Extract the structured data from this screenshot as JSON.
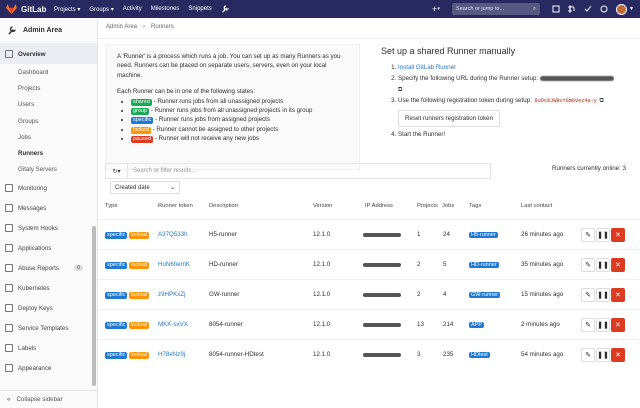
{
  "topbar": {
    "brand": "GitLab",
    "nav": [
      "Projects ▾",
      "Groups ▾",
      "Activity",
      "Milestones",
      "Snippets"
    ],
    "search_placeholder": "Search or jump to...",
    "colors": {
      "bg": "#292961"
    }
  },
  "sidebar": {
    "title": "Admin Area",
    "items": [
      {
        "label": "Overview",
        "active": true
      },
      {
        "label": "Dashboard",
        "sub": true
      },
      {
        "label": "Projects",
        "sub": true
      },
      {
        "label": "Users",
        "sub": true
      },
      {
        "label": "Groups",
        "sub": true
      },
      {
        "label": "Jobs",
        "sub": true
      },
      {
        "label": "Runners",
        "sub": true,
        "active": true
      },
      {
        "label": "Gitaly Servers",
        "sub": true
      },
      {
        "label": "Monitoring"
      },
      {
        "label": "Messages"
      },
      {
        "label": "System Hooks"
      },
      {
        "label": "Applications"
      },
      {
        "label": "Abuse Reports",
        "count": "0"
      },
      {
        "label": "Kubernetes"
      },
      {
        "label": "Deploy Keys"
      },
      {
        "label": "Service Templates"
      },
      {
        "label": "Labels"
      },
      {
        "label": "Appearance"
      }
    ],
    "collapse": "Collapse sidebar"
  },
  "breadcrumb": {
    "root": "Admin Area",
    "sep": "›",
    "current": "Runners"
  },
  "info": {
    "intro": "A 'Runner' is a process which runs a job. You can set up as many Runners as you need. Runners can be placed on separate users, servers, even on your local machine.",
    "states_title": "Each Runner can be in one of the following states:",
    "states": [
      {
        "badge": "shared",
        "text": "- Runner runs jobs from all unassigned projects"
      },
      {
        "badge": "group",
        "text": "- Runner runs jobs from all unassigned projects in its group"
      },
      {
        "badge": "specific",
        "text": "- Runner runs jobs from assigned projects"
      },
      {
        "badge": "locked",
        "text": "- Runner cannot be assigned to other projects"
      },
      {
        "badge": "paused",
        "text": "- Runner will not receive any new jobs"
      }
    ]
  },
  "setup": {
    "title": "Set up a shared Runner manually",
    "step1": "Install GitLab Runner",
    "step2": "Specify the following URL during the Runner setup:",
    "step3": "Use the following registration token during setup:",
    "token": "8uDc8JWBvYGm6vez4a-y",
    "reset": "Reset runners registration token",
    "step4": "Start the Runner!"
  },
  "filter": {
    "placeholder": "Search or filter results...",
    "online": "Runners currently online: 3",
    "sort": "Created date"
  },
  "table": {
    "headers": [
      "Type",
      "Runner token",
      "Description",
      "Version",
      "IP Address",
      "Projects",
      "Jobs",
      "Tags",
      "Last contact"
    ],
    "rows": [
      {
        "token": "A37Q533h",
        "desc": "H5-runner",
        "version": "12.1.0",
        "projects": "1",
        "jobs": "24",
        "tag": "H5-runner",
        "contact": "26 minutes ago"
      },
      {
        "token": "HoN6hemK",
        "desc": "HD-runner",
        "version": "12.1.0",
        "projects": "2",
        "jobs": "5",
        "tag": "HD-runner",
        "contact": "35 minutes ago"
      },
      {
        "token": "z9HPKxZj",
        "desc": "GW-runner",
        "version": "12.1.0",
        "projects": "2",
        "jobs": "4",
        "tag": "GW-runner",
        "contact": "15 minutes ago"
      },
      {
        "token": "MKK-sxVX",
        "desc": "8054-runner",
        "version": "12.1.0",
        "projects": "13",
        "jobs": "214",
        "tag": "APP",
        "contact": "2 minutes ago"
      },
      {
        "token": "H78eNz9j",
        "desc": "8054-runner-HDtest",
        "version": "12.1.0",
        "projects": "3",
        "jobs": "235",
        "tag": "HDtest",
        "contact": "54 minutes ago"
      }
    ],
    "badge_specific": "specific",
    "badge_locked": "locked"
  }
}
